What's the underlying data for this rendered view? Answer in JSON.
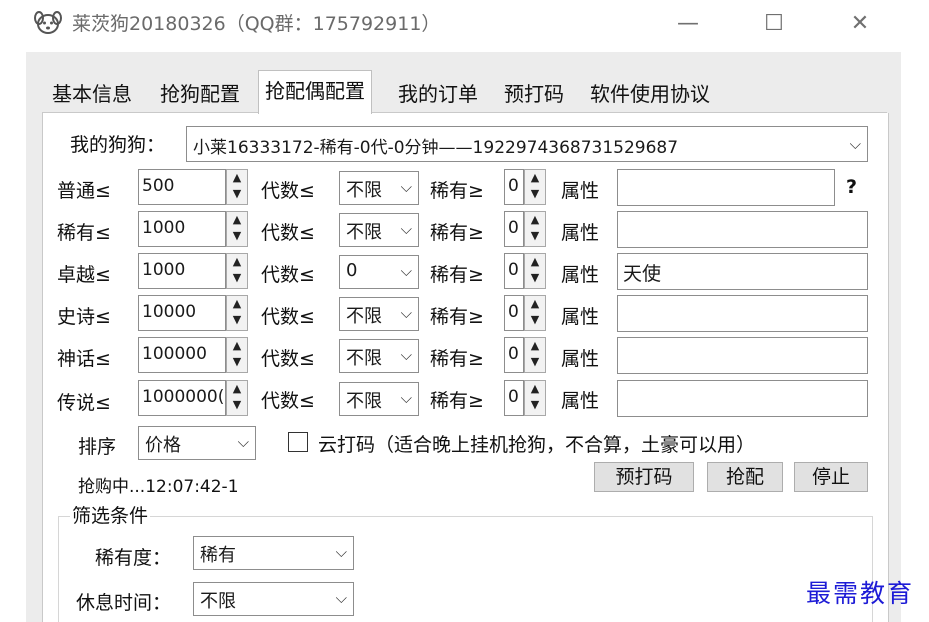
{
  "window": {
    "title": "莱茨狗20180326（QQ群：175792911）",
    "controls": {
      "minimize": "—",
      "maximize": "☐",
      "close": "✕"
    }
  },
  "tabs": [
    {
      "label": "基本信息",
      "active": false
    },
    {
      "label": "抢狗配置",
      "active": false
    },
    {
      "label": "抢配偶配置",
      "active": true
    },
    {
      "label": "我的订单",
      "active": false
    },
    {
      "label": "预打码",
      "active": false
    },
    {
      "label": "软件使用协议",
      "active": false
    }
  ],
  "my_dog": {
    "label": "我的狗狗：",
    "value": "小莱16333172-稀有-0代-0分钟——1922974368731529687"
  },
  "rows": [
    {
      "label": "普通≤",
      "price": "500",
      "gen_label": "代数≤",
      "gen": "不限",
      "rarity_label": "稀有≥",
      "rarity": "0",
      "attr_label": "属性",
      "attr": ""
    },
    {
      "label": "稀有≤",
      "price": "1000",
      "gen_label": "代数≤",
      "gen": "不限",
      "rarity_label": "稀有≥",
      "rarity": "0",
      "attr_label": "属性",
      "attr": ""
    },
    {
      "label": "卓越≤",
      "price": "1000",
      "gen_label": "代数≤",
      "gen": "0",
      "rarity_label": "稀有≥",
      "rarity": "0",
      "attr_label": "属性",
      "attr": "天使"
    },
    {
      "label": "史诗≤",
      "price": "10000",
      "gen_label": "代数≤",
      "gen": "不限",
      "rarity_label": "稀有≥",
      "rarity": "0",
      "attr_label": "属性",
      "attr": ""
    },
    {
      "label": "神话≤",
      "price": "100000",
      "gen_label": "代数≤",
      "gen": "不限",
      "rarity_label": "稀有≥",
      "rarity": "0",
      "attr_label": "属性",
      "attr": ""
    },
    {
      "label": "传说≤",
      "price": "1000000(",
      "gen_label": "代数≤",
      "gen": "不限",
      "rarity_label": "稀有≥",
      "rarity": "0",
      "attr_label": "属性",
      "attr": ""
    }
  ],
  "help_glyph": "?",
  "sort": {
    "label": "排序",
    "value": "价格"
  },
  "cloud_captcha": {
    "checked": false,
    "label": "云打码（适合晚上挂机抢狗，不合算，土豪可以用）"
  },
  "status_text": "抢购中...12:07:42-1",
  "buttons": {
    "pre_captcha": "预打码",
    "grab_mate": "抢配",
    "stop": "停止"
  },
  "filter": {
    "title": "筛选条件",
    "rarity_label": "稀有度：",
    "rarity_value": "稀有",
    "rest_label": "休息时间：",
    "rest_value": "不限"
  },
  "watermark": "最需教育"
}
